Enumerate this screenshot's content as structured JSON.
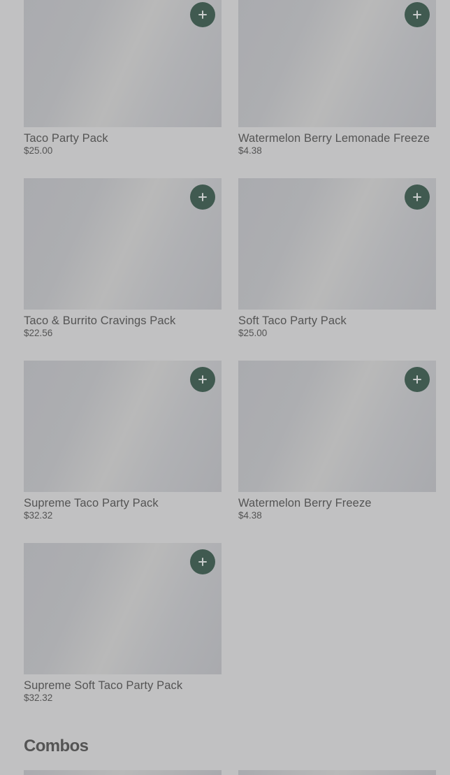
{
  "products": [
    {
      "name": "Taco Party Pack",
      "price": "$25.00",
      "add_icon": "plus-icon"
    },
    {
      "name": "Watermelon Berry Lemonade Freeze",
      "price": "$4.38",
      "add_icon": "plus-icon"
    },
    {
      "name": "Taco & Burrito Cravings Pack",
      "price": "$22.56",
      "add_icon": "plus-icon"
    },
    {
      "name": "Soft Taco Party Pack",
      "price": "$25.00",
      "add_icon": "plus-icon"
    },
    {
      "name": "Supreme Taco Party Pack",
      "price": "$32.32",
      "add_icon": "plus-icon"
    },
    {
      "name": "Watermelon Berry Freeze",
      "price": "$4.38",
      "add_icon": "plus-icon"
    },
    {
      "name": "Supreme Soft Taco Party Pack",
      "price": "$32.32",
      "add_icon": "plus-icon"
    }
  ],
  "sections": {
    "combos_title": "Combos"
  },
  "colors": {
    "add_button": "#405a50",
    "text": "#545454",
    "overlay_background": "#c1c1c2"
  }
}
